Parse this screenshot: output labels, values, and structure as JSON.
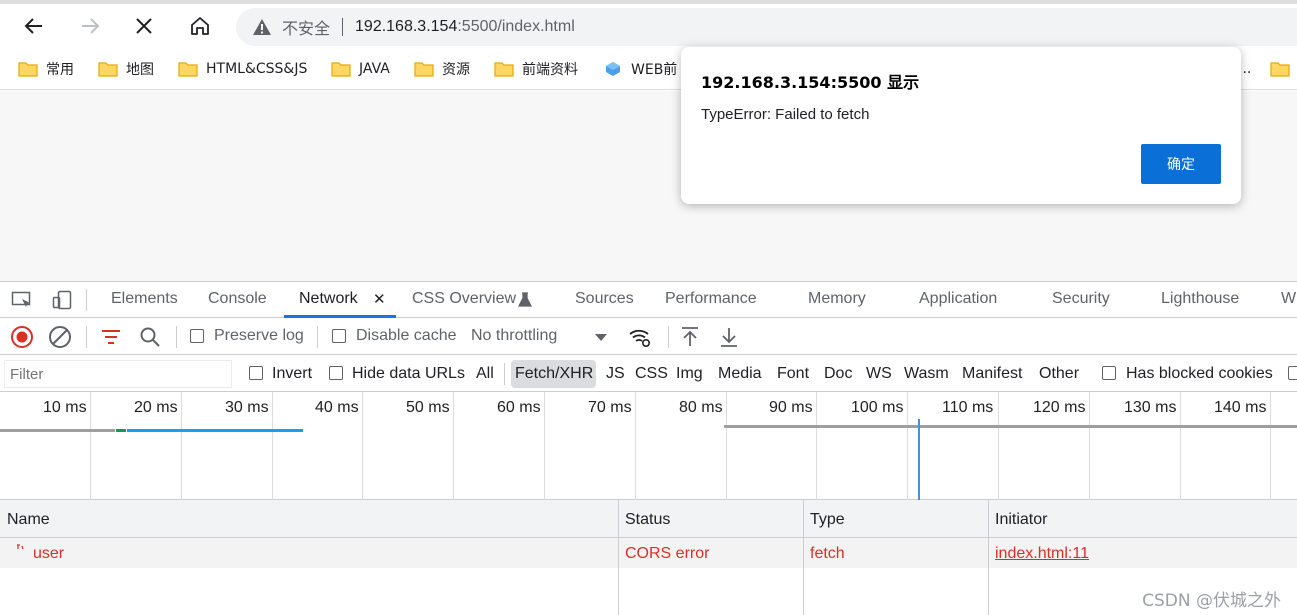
{
  "browser": {
    "security_label": "不安全",
    "url_host": "192.168.3.154",
    "url_rest": ":5500/index.html"
  },
  "bookmarks": [
    "常用",
    "地图",
    "HTML&CSS&JS",
    "JAVA",
    "资源",
    "前端资料",
    "WEB前"
  ],
  "bookmarks_overflow": "...",
  "dialog": {
    "title": "192.168.3.154:5500 显示",
    "message": "TypeError: Failed to fetch",
    "ok_label": "确定"
  },
  "devtools": {
    "tabs": [
      "Elements",
      "Console",
      "Network",
      "CSS Overview",
      "Sources",
      "Performance",
      "Memory",
      "Application",
      "Security",
      "Lighthouse",
      "W"
    ],
    "active_tab": "Network",
    "close_glyph": "✕",
    "toolbar": {
      "preserve_log": "Preserve log",
      "disable_cache": "Disable cache",
      "throttling": "No throttling"
    },
    "filter": {
      "placeholder": "Filter",
      "invert": "Invert",
      "hide_data_urls": "Hide data URLs",
      "types": [
        "All",
        "Fetch/XHR",
        "JS",
        "CSS",
        "Img",
        "Media",
        "Font",
        "Doc",
        "WS",
        "Wasm",
        "Manifest",
        "Other"
      ],
      "selected_type": "Fetch/XHR",
      "has_blocked_cookies": "Has blocked cookies"
    },
    "timeline_ticks": [
      "10 ms",
      "20 ms",
      "30 ms",
      "40 ms",
      "50 ms",
      "60 ms",
      "70 ms",
      "80 ms",
      "90 ms",
      "100 ms",
      "110 ms",
      "120 ms",
      "130 ms",
      "140 ms"
    ],
    "table": {
      "columns": [
        "Name",
        "Status",
        "Type",
        "Initiator"
      ],
      "rows": [
        {
          "name": "user",
          "status": "CORS error",
          "type": "fetch",
          "initiator": "index.html:11"
        }
      ]
    }
  },
  "watermark": "CSDN @伏城之外",
  "colors": {
    "accent": "#1a73e8",
    "error": "#d93025",
    "dialog_button": "#0a6fd6"
  }
}
